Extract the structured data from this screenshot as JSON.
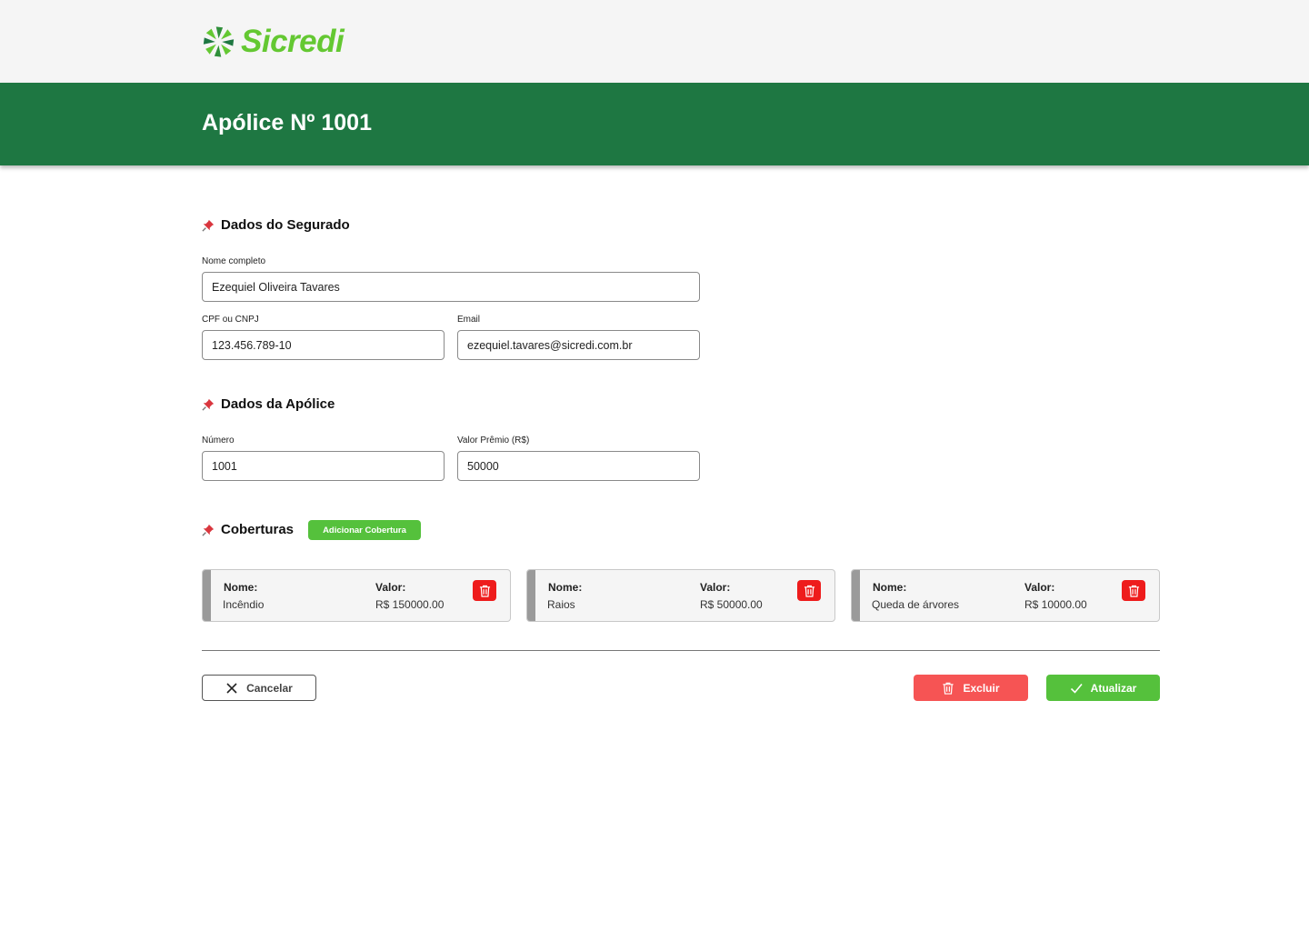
{
  "brand": {
    "name": "Sicredi",
    "color": "#64c832"
  },
  "header": {
    "title": "Apólice Nº 1001",
    "color": "#1e7742"
  },
  "segurado": {
    "title": "Dados do Segurado",
    "nome_label": "Nome completo",
    "nome_value": "Ezequiel Oliveira Tavares",
    "cpf_label": "CPF ou CNPJ",
    "cpf_value": "123.456.789-10",
    "email_label": "Email",
    "email_value": "ezequiel.tavares@sicredi.com.br"
  },
  "apolice": {
    "title": "Dados da Apólice",
    "numero_label": "Número",
    "numero_value": "1001",
    "valor_label": "Valor Prêmio (R$)",
    "valor_value": "50000"
  },
  "coberturas": {
    "title": "Coberturas",
    "add_label": "Adicionar Cobertura",
    "name_label": "Nome:",
    "value_label": "Valor:",
    "items": [
      {
        "name": "Incêndio",
        "value": "R$ 150000.00"
      },
      {
        "name": "Raios",
        "value": "R$ 50000.00"
      },
      {
        "name": "Queda de árvores",
        "value": "R$ 10000.00"
      }
    ]
  },
  "actions": {
    "cancel": "Cancelar",
    "delete": "Excluir",
    "update": "Atualizar"
  },
  "icons": {
    "section": "pushpin-icon",
    "delete": "trash-icon",
    "cancel": "close-icon",
    "update": "check-icon"
  },
  "colors": {
    "delete_red": "#ee1c1c",
    "excluir": "#f65454",
    "accent_green": "#55c13c"
  }
}
